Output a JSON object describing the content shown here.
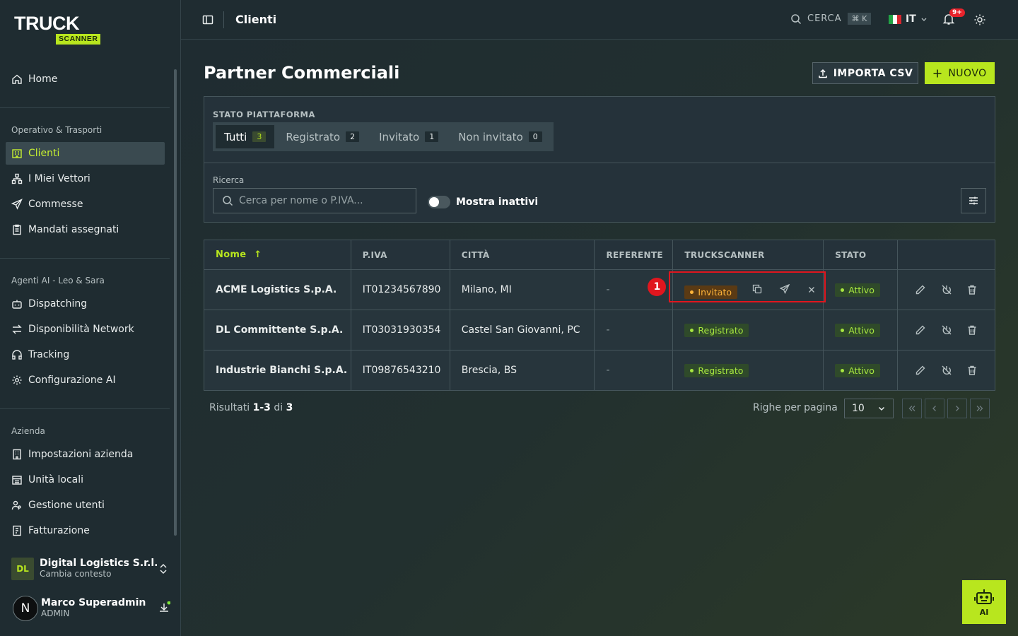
{
  "brand": {
    "logo_main": "TRUCK",
    "logo_sub": "SCANNER",
    "accent": "#b8e61e"
  },
  "sidebar": {
    "home": "Home",
    "sections": [
      {
        "title": "Operativo & Trasporti",
        "items": [
          "Clienti",
          "I Miei Vettori",
          "Commesse",
          "Mandati assegnati"
        ]
      },
      {
        "title": "Agenti AI - Leo & Sara",
        "items": [
          "Dispatching",
          "Disponibilità Network",
          "Tracking",
          "Configurazione AI"
        ]
      },
      {
        "title": "Azienda",
        "items": [
          "Impostazioni azienda",
          "Unità locali",
          "Gestione utenti",
          "Fatturazione"
        ]
      }
    ],
    "active_item": "Clienti",
    "context": {
      "initials": "DL",
      "name": "Digital Logistics S.r.l.",
      "subtitle": "Cambia contesto"
    },
    "user": {
      "avatar": "N",
      "name": "Marco Superadmin",
      "role": "ADMIN"
    }
  },
  "topbar": {
    "title": "Clienti",
    "search_label": "CERCA",
    "search_shortcut": "⌘ K",
    "language": "IT",
    "notifications": "9+"
  },
  "page": {
    "title": "Partner Commerciali",
    "import_button": "IMPORTA CSV",
    "new_button": "NUOVO",
    "filter_label": "STATO PIATTAFORMA",
    "tabs": [
      {
        "label": "Tutti",
        "count": "3"
      },
      {
        "label": "Registrato",
        "count": "2"
      },
      {
        "label": "Invitato",
        "count": "1"
      },
      {
        "label": "Non invitato",
        "count": "0"
      }
    ],
    "search_label": "Ricerca",
    "search_placeholder": "Cerca per nome o P.IVA...",
    "toggle_label": "Mostra inattivi"
  },
  "table": {
    "columns": [
      "Nome",
      "P.IVA",
      "CITTÀ",
      "REFERENTE",
      "TRUCKSCANNER",
      "STATO"
    ],
    "rows": [
      {
        "name": "ACME Logistics S.p.A.",
        "piva": "IT01234567890",
        "city": "Milano, MI",
        "ref": "-",
        "ts": "Invitato",
        "state": "Attivo"
      },
      {
        "name": "DL Committente S.p.A.",
        "piva": "IT03031930354",
        "city": "Castel San Giovanni, PC",
        "ref": "-",
        "ts": "Registrato",
        "state": "Attivo"
      },
      {
        "name": "Industrie Bianchi S.p.A.",
        "piva": "IT09876543210",
        "city": "Brescia, BS",
        "ref": "-",
        "ts": "Registrato",
        "state": "Attivo"
      }
    ]
  },
  "annotation": {
    "marker": "1"
  },
  "footer": {
    "results_prefix": "Risultati",
    "results_range": "1-3",
    "results_of": "di",
    "results_total": "3",
    "rows_per_page_label": "Righe per pagina",
    "rows_per_page": "10"
  },
  "ai_button": "AI"
}
